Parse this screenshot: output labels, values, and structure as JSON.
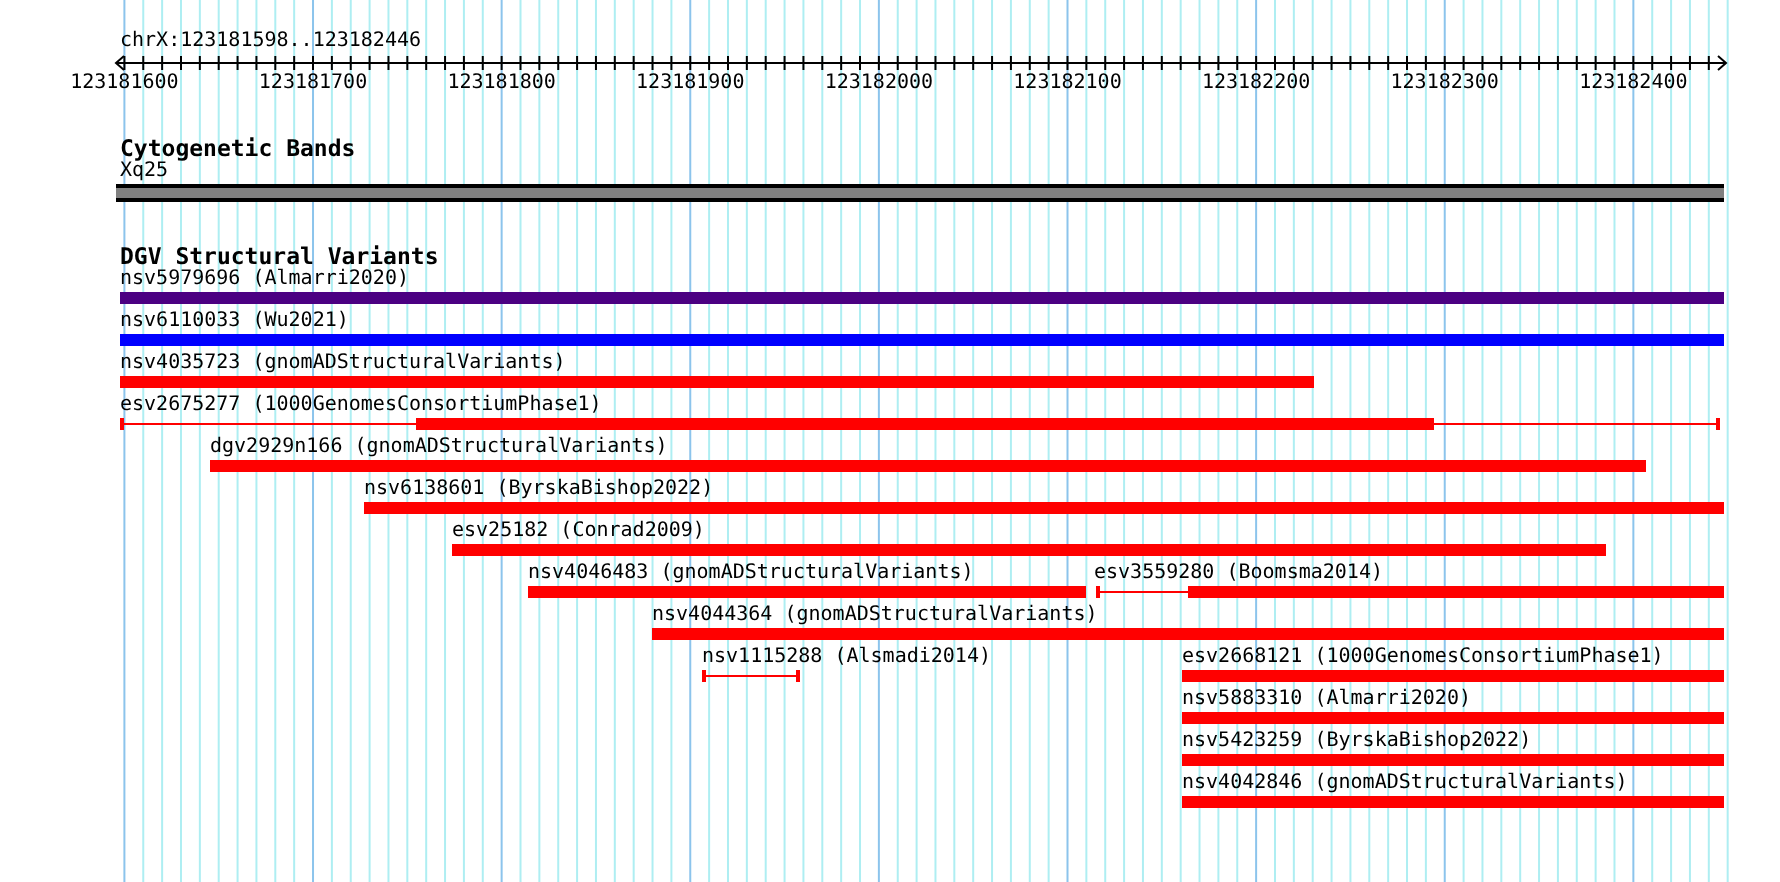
{
  "ruler": {
    "location": "chrX:123181598..123182446",
    "ticks": [
      "123181600",
      "123181700",
      "123181800",
      "123181900",
      "123182000",
      "123182100",
      "123182200",
      "123182300",
      "123182400"
    ]
  },
  "cytogenetic_bands": {
    "title": "Cytogenetic Bands",
    "band": "Xq25"
  },
  "dgv_structural_variants": {
    "title": "DGV Structural Variants",
    "rows": [
      {
        "features": [
          {
            "label": "nsv5979696 (Almarri2020)",
            "kind": "solid",
            "color": "#4b0082"
          }
        ]
      },
      {
        "features": [
          {
            "label": "nsv6110033 (Wu2021)",
            "kind": "solid",
            "color": "#0000ff"
          }
        ]
      },
      {
        "features": [
          {
            "label": "nsv4035723 (gnomADStructuralVariants)",
            "kind": "solid",
            "color": "#ff0000"
          }
        ]
      },
      {
        "features": [
          {
            "label": "esv2675277 (1000GenomesConsortiumPhase1)",
            "kind": "split",
            "color": "#ff0000"
          }
        ]
      },
      {
        "features": [
          {
            "label": "dgv2929n166 (gnomADStructuralVariants)",
            "kind": "solid",
            "color": "#ff0000"
          }
        ]
      },
      {
        "features": [
          {
            "label": "nsv6138601 (ByrskaBishop2022)",
            "kind": "solid",
            "color": "#ff0000"
          }
        ]
      },
      {
        "features": [
          {
            "label": "esv25182 (Conrad2009)",
            "kind": "solid",
            "color": "#ff0000"
          }
        ]
      },
      {
        "features": [
          {
            "label": "nsv4046483 (gnomADStructuralVariants)",
            "kind": "solid",
            "color": "#ff0000"
          },
          {
            "label": "esv3559280 (Boomsma2014)",
            "kind": "split",
            "color": "#ff0000"
          }
        ]
      },
      {
        "features": [
          {
            "label": "nsv4044364 (gnomADStructuralVariants)",
            "kind": "solid",
            "color": "#ff0000"
          }
        ]
      },
      {
        "features": [
          {
            "label": "nsv1115288 (Alsmadi2014)",
            "kind": "line",
            "color": "#ff0000"
          },
          {
            "label": "esv2668121 (1000GenomesConsortiumPhase1)",
            "kind": "solid",
            "color": "#ff0000"
          }
        ]
      },
      {
        "features": [
          {
            "label": "nsv5883310 (Almarri2020)",
            "kind": "solid",
            "color": "#ff0000"
          }
        ]
      },
      {
        "features": [
          {
            "label": "nsv5423259 (ByrskaBishop2022)",
            "kind": "solid",
            "color": "#ff0000"
          }
        ]
      },
      {
        "features": [
          {
            "label": "nsv4042846 (gnomADStructuralVariants)",
            "kind": "solid",
            "color": "#ff0000"
          }
        ]
      }
    ]
  }
}
